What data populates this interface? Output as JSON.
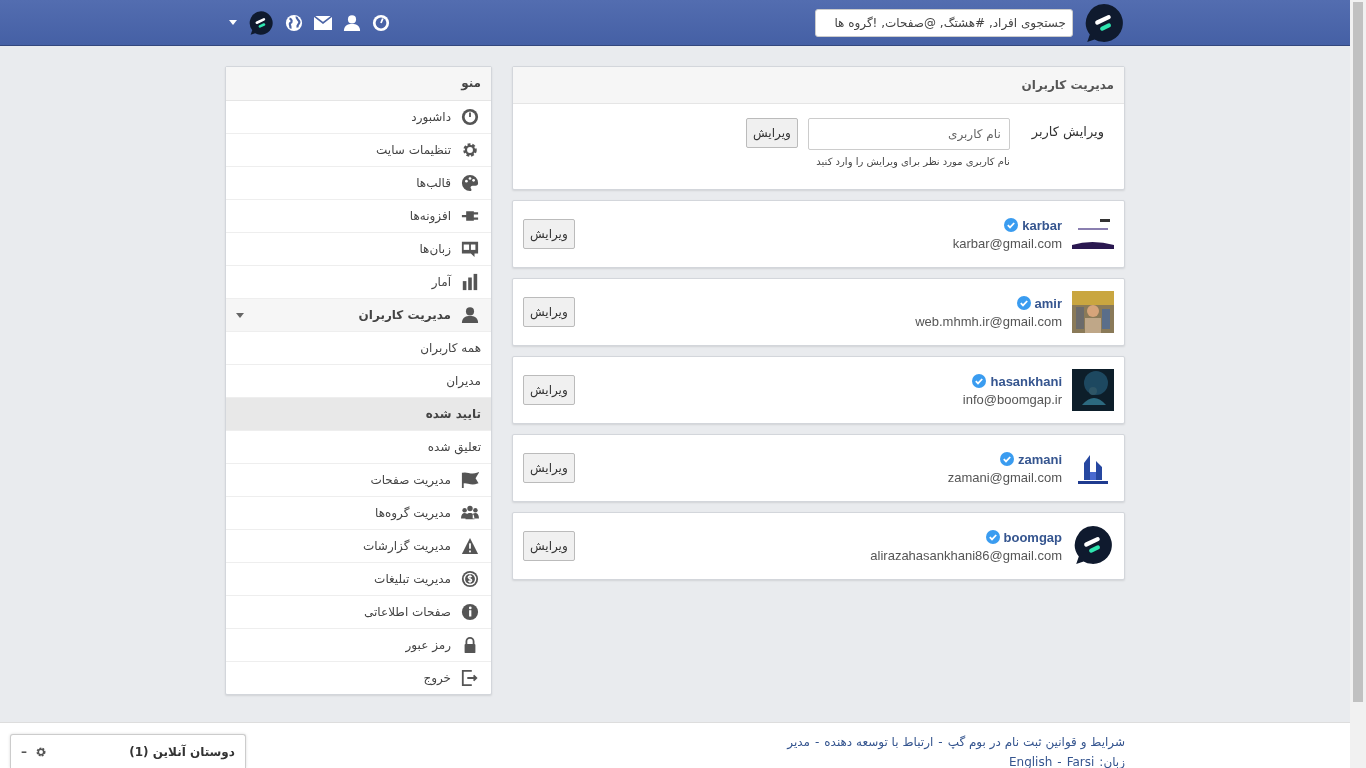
{
  "header": {
    "search": {
      "placeholder": "جستجوی افراد, #هشتگ, @صفحات, !گروه ها"
    }
  },
  "sidebar": {
    "title": "منو",
    "items": [
      {
        "label": "داشبورد",
        "selected": false
      },
      {
        "label": "تنظیمات سایت",
        "selected": false
      },
      {
        "label": "قالب‌ها",
        "selected": false
      },
      {
        "label": "افزونه‌ها",
        "selected": false
      },
      {
        "label": "زبان‌ها",
        "selected": false
      },
      {
        "label": "آمار",
        "selected": false
      },
      {
        "label": "مدیریت کاربران",
        "selected": false,
        "expanded": true,
        "children": [
          {
            "label": "همه کاربران",
            "selected": false
          },
          {
            "label": "مدیران",
            "selected": false
          },
          {
            "label": "تایید شده",
            "selected": true
          },
          {
            "label": "تعلیق شده",
            "selected": false
          }
        ]
      },
      {
        "label": "مدیریت صفحات",
        "selected": false
      },
      {
        "label": "مدیریت گروه‌ها",
        "selected": false
      },
      {
        "label": "مدیریت گزارشات",
        "selected": false
      },
      {
        "label": "مدیریت تبلیغات",
        "selected": false
      },
      {
        "label": "صفحات اطلاعاتی",
        "selected": false
      },
      {
        "label": "رمز عبور",
        "selected": false
      },
      {
        "label": "خروج",
        "selected": false
      }
    ]
  },
  "panel": {
    "title": "مدیریت کاربران",
    "label": "ویرایش کاربر",
    "placeholder": "نام کاربری",
    "button": "ویرایش",
    "help": "نام کاربری مورد نظر برای ویرایش را وارد کنید"
  },
  "users": [
    {
      "name": "karbar",
      "verified": true,
      "email": "karbar@gmail.com",
      "button": "ویرایش",
      "kind": "picture"
    },
    {
      "name": "amir",
      "verified": true,
      "email": "web.mhmh.ir@gmail.com",
      "button": "ویرایش",
      "kind": "picture"
    },
    {
      "name": "hasankhani",
      "verified": true,
      "email": "info@boomgap.ir",
      "button": "ویرایش",
      "kind": "picture"
    },
    {
      "name": "zamani",
      "verified": true,
      "email": "zamani@gmail.com",
      "button": "ویرایش",
      "kind": "picture"
    },
    {
      "name": "boomgap",
      "verified": true,
      "email": "alirazahasankhani86@gmail.com",
      "button": "ویرایش",
      "kind": "logo"
    }
  ],
  "footer": {
    "links": [
      "شرایط و قوانین ثبت نام در بوم گپ",
      "ارتباط با توسعه دهنده",
      "مدیر"
    ],
    "separator": "-",
    "language_label": "زبان:",
    "languages": [
      "Farsi",
      "English"
    ]
  },
  "chat": {
    "title": "دوستان آنلاین (1)",
    "minimize": "–"
  }
}
